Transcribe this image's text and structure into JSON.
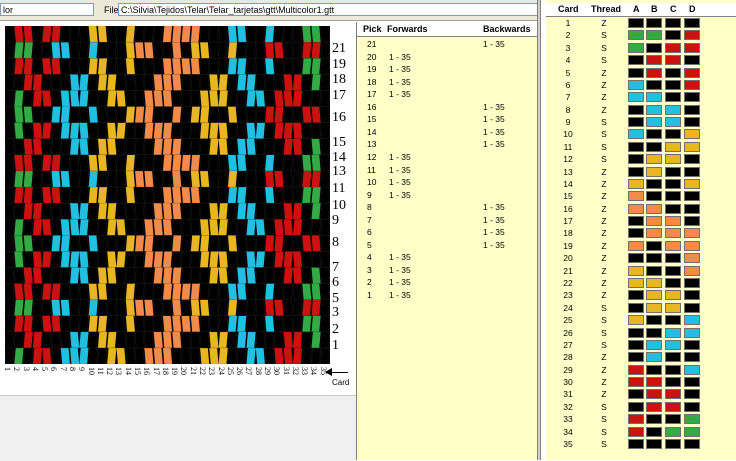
{
  "toolbar": {
    "left_field": "lor",
    "file_label": "File",
    "file_path": "C:\\Silvia\\Tejidos\\Telar\\Telar_tarjetas\\gtt\\Multicolor1.gtt"
  },
  "colors": {
    "K": "#000000",
    "R": "#cc1111",
    "G": "#33aa44",
    "C": "#22c0e0",
    "Y": "#e8b622",
    "O": "#f28a4a"
  },
  "pattern": {
    "pick_labels": [
      "21",
      "19",
      "18",
      "17",
      "16",
      "15",
      "14",
      "13",
      "11",
      "10",
      "9",
      "8",
      "7",
      "6",
      "5",
      "3",
      "2",
      "1"
    ],
    "card_numbers": [
      "1",
      "2",
      "3",
      "4",
      "5",
      "6",
      "7",
      "8",
      "9",
      "10",
      "11",
      "12",
      "13",
      "14",
      "15",
      "16",
      "17",
      "18",
      "19",
      "20",
      "21",
      "22",
      "23",
      "24",
      "25",
      "26",
      "27",
      "28",
      "29",
      "30",
      "31",
      "32",
      "33",
      "34",
      "35"
    ],
    "card_arrow_label": "Card"
  },
  "picks": {
    "headers": {
      "pick": "Pick",
      "forwards": "Forwards",
      "backwards": "Backwards"
    },
    "rows": [
      {
        "pick": "21",
        "forwards": "",
        "backwards": "1 - 35"
      },
      {
        "pick": "20",
        "forwards": "1 - 35",
        "backwards": ""
      },
      {
        "pick": "19",
        "forwards": "1 - 35",
        "backwards": ""
      },
      {
        "pick": "18",
        "forwards": "1 - 35",
        "backwards": ""
      },
      {
        "pick": "17",
        "forwards": "1 - 35",
        "backwards": ""
      },
      {
        "pick": "16",
        "forwards": "",
        "backwards": "1 - 35"
      },
      {
        "pick": "15",
        "forwards": "",
        "backwards": "1 - 35"
      },
      {
        "pick": "14",
        "forwards": "",
        "backwards": "1 - 35"
      },
      {
        "pick": "13",
        "forwards": "",
        "backwards": "1 - 35"
      },
      {
        "pick": "12",
        "forwards": "1 - 35",
        "backwards": ""
      },
      {
        "pick": "11",
        "forwards": "1 - 35",
        "backwards": ""
      },
      {
        "pick": "10",
        "forwards": "1 - 35",
        "backwards": ""
      },
      {
        "pick": "9",
        "forwards": "1 - 35",
        "backwards": ""
      },
      {
        "pick": "8",
        "forwards": "",
        "backwards": "1 - 35"
      },
      {
        "pick": "7",
        "forwards": "",
        "backwards": "1 - 35"
      },
      {
        "pick": "6",
        "forwards": "",
        "backwards": "1 - 35"
      },
      {
        "pick": "5",
        "forwards": "",
        "backwards": "1 - 35"
      },
      {
        "pick": "4",
        "forwards": "1 - 35",
        "backwards": ""
      },
      {
        "pick": "3",
        "forwards": "1 - 35",
        "backwards": ""
      },
      {
        "pick": "2",
        "forwards": "1 - 35",
        "backwards": ""
      },
      {
        "pick": "1",
        "forwards": "1 - 35",
        "backwards": ""
      }
    ]
  },
  "cards": {
    "headers": {
      "card": "Card",
      "thread": "Thread",
      "a": "A",
      "b": "B",
      "c": "C",
      "d": "D"
    },
    "rows": [
      {
        "card": "1",
        "thread": "Z",
        "holes": [
          "K",
          "K",
          "K",
          "K"
        ]
      },
      {
        "card": "2",
        "thread": "S",
        "holes": [
          "G",
          "G",
          "K",
          "R"
        ]
      },
      {
        "card": "3",
        "thread": "S",
        "holes": [
          "G",
          "K",
          "R",
          "R"
        ]
      },
      {
        "card": "4",
        "thread": "S",
        "holes": [
          "K",
          "R",
          "R",
          "K"
        ]
      },
      {
        "card": "5",
        "thread": "Z",
        "holes": [
          "K",
          "R",
          "K",
          "R"
        ]
      },
      {
        "card": "6",
        "thread": "Z",
        "holes": [
          "C",
          "K",
          "K",
          "R"
        ]
      },
      {
        "card": "7",
        "thread": "Z",
        "holes": [
          "C",
          "C",
          "K",
          "K"
        ]
      },
      {
        "card": "8",
        "thread": "Z",
        "holes": [
          "K",
          "C",
          "C",
          "K"
        ]
      },
      {
        "card": "9",
        "thread": "S",
        "holes": [
          "K",
          "C",
          "C",
          "K"
        ]
      },
      {
        "card": "10",
        "thread": "S",
        "holes": [
          "C",
          "K",
          "K",
          "Y"
        ]
      },
      {
        "card": "11",
        "thread": "S",
        "holes": [
          "K",
          "K",
          "Y",
          "Y"
        ]
      },
      {
        "card": "12",
        "thread": "S",
        "holes": [
          "K",
          "Y",
          "Y",
          "K"
        ]
      },
      {
        "card": "13",
        "thread": "Z",
        "holes": [
          "K",
          "Y",
          "K",
          "K"
        ]
      },
      {
        "card": "14",
        "thread": "Z",
        "holes": [
          "Y",
          "K",
          "K",
          "Y"
        ]
      },
      {
        "card": "15",
        "thread": "Z",
        "holes": [
          "O",
          "K",
          "K",
          "K"
        ]
      },
      {
        "card": "16",
        "thread": "Z",
        "holes": [
          "O",
          "O",
          "K",
          "K"
        ]
      },
      {
        "card": "17",
        "thread": "Z",
        "holes": [
          "K",
          "O",
          "O",
          "K"
        ]
      },
      {
        "card": "18",
        "thread": "Z",
        "holes": [
          "K",
          "O",
          "O",
          "O"
        ]
      },
      {
        "card": "19",
        "thread": "Z",
        "holes": [
          "O",
          "K",
          "O",
          "O"
        ]
      },
      {
        "card": "20",
        "thread": "Z",
        "holes": [
          "K",
          "K",
          "K",
          "O"
        ]
      },
      {
        "card": "21",
        "thread": "Z",
        "holes": [
          "Y",
          "K",
          "K",
          "O"
        ]
      },
      {
        "card": "22",
        "thread": "Z",
        "holes": [
          "Y",
          "Y",
          "K",
          "K"
        ]
      },
      {
        "card": "23",
        "thread": "Z",
        "holes": [
          "K",
          "Y",
          "Y",
          "K"
        ]
      },
      {
        "card": "24",
        "thread": "S",
        "holes": [
          "K",
          "Y",
          "Y",
          "K"
        ]
      },
      {
        "card": "25",
        "thread": "S",
        "holes": [
          "Y",
          "K",
          "K",
          "C"
        ]
      },
      {
        "card": "26",
        "thread": "S",
        "holes": [
          "K",
          "K",
          "C",
          "C"
        ]
      },
      {
        "card": "27",
        "thread": "S",
        "holes": [
          "K",
          "C",
          "C",
          "K"
        ]
      },
      {
        "card": "28",
        "thread": "Z",
        "holes": [
          "K",
          "C",
          "K",
          "K"
        ]
      },
      {
        "card": "29",
        "thread": "Z",
        "holes": [
          "R",
          "K",
          "K",
          "C"
        ]
      },
      {
        "card": "30",
        "thread": "Z",
        "holes": [
          "R",
          "R",
          "K",
          "K"
        ]
      },
      {
        "card": "31",
        "thread": "Z",
        "holes": [
          "K",
          "R",
          "R",
          "K"
        ]
      },
      {
        "card": "32",
        "thread": "S",
        "holes": [
          "K",
          "R",
          "R",
          "K"
        ]
      },
      {
        "card": "33",
        "thread": "S",
        "holes": [
          "R",
          "K",
          "K",
          "G"
        ]
      },
      {
        "card": "34",
        "thread": "S",
        "holes": [
          "R",
          "K",
          "G",
          "G"
        ]
      },
      {
        "card": "35",
        "thread": "S",
        "holes": [
          "K",
          "K",
          "K",
          "K"
        ]
      }
    ]
  }
}
